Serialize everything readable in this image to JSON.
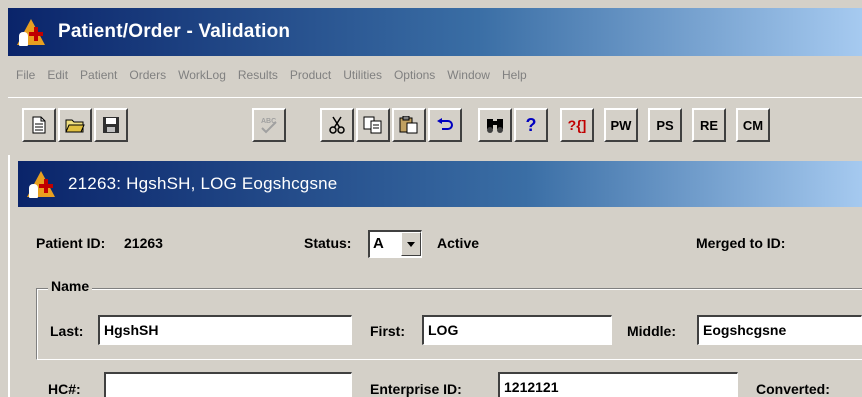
{
  "app": {
    "title": "Patient/Order - Validation"
  },
  "menu": {
    "items": [
      "File",
      "Edit",
      "Patient",
      "Orders",
      "WorkLog",
      "Results",
      "Product",
      "Utilities",
      "Options",
      "Window",
      "Help"
    ]
  },
  "toolbar": {
    "buttons": [
      {
        "name": "new-button",
        "icon": "new-document-icon"
      },
      {
        "name": "open-button",
        "icon": "open-folder-icon"
      },
      {
        "name": "save-button",
        "icon": "save-disk-icon"
      },
      {
        "name": "spellcheck-button",
        "icon": "spellcheck-icon",
        "disabled": true
      },
      {
        "name": "cut-button",
        "icon": "scissors-icon"
      },
      {
        "name": "copy-button",
        "icon": "copy-icon"
      },
      {
        "name": "paste-button",
        "icon": "paste-icon"
      },
      {
        "name": "undo-button",
        "icon": "undo-icon"
      },
      {
        "name": "find-button",
        "icon": "binoculars-icon"
      },
      {
        "name": "help-button",
        "icon": "question-icon"
      },
      {
        "name": "context-help-button",
        "icon": "context-help-icon"
      }
    ],
    "text_buttons": {
      "q": "?",
      "qctx": "?{]",
      "pw": "PW",
      "ps": "PS",
      "re": "RE",
      "cm": "CM"
    }
  },
  "child_window": {
    "title": "21263: HgshSH, LOG Eogshcgsne"
  },
  "form": {
    "patient_id_label": "Patient ID:",
    "patient_id_value": "21263",
    "status_label": "Status:",
    "status_value": "A",
    "status_text": "Active",
    "merged_label": "Merged to ID:",
    "name_group_label": "Name",
    "last_label": "Last:",
    "last_value": "HgshSH",
    "first_label": "First:",
    "first_value": "LOG",
    "middle_label": "Middle:",
    "middle_value": "Eogshcgsne",
    "hc_label": "HC#:",
    "hc_value": "",
    "enterprise_label": "Enterprise ID:",
    "enterprise_value": "1212121",
    "converted_label": "Converted:"
  },
  "colors": {
    "titlebar_start": "#0a246a",
    "titlebar_end": "#a6caf0",
    "face": "#d4d0c8"
  }
}
